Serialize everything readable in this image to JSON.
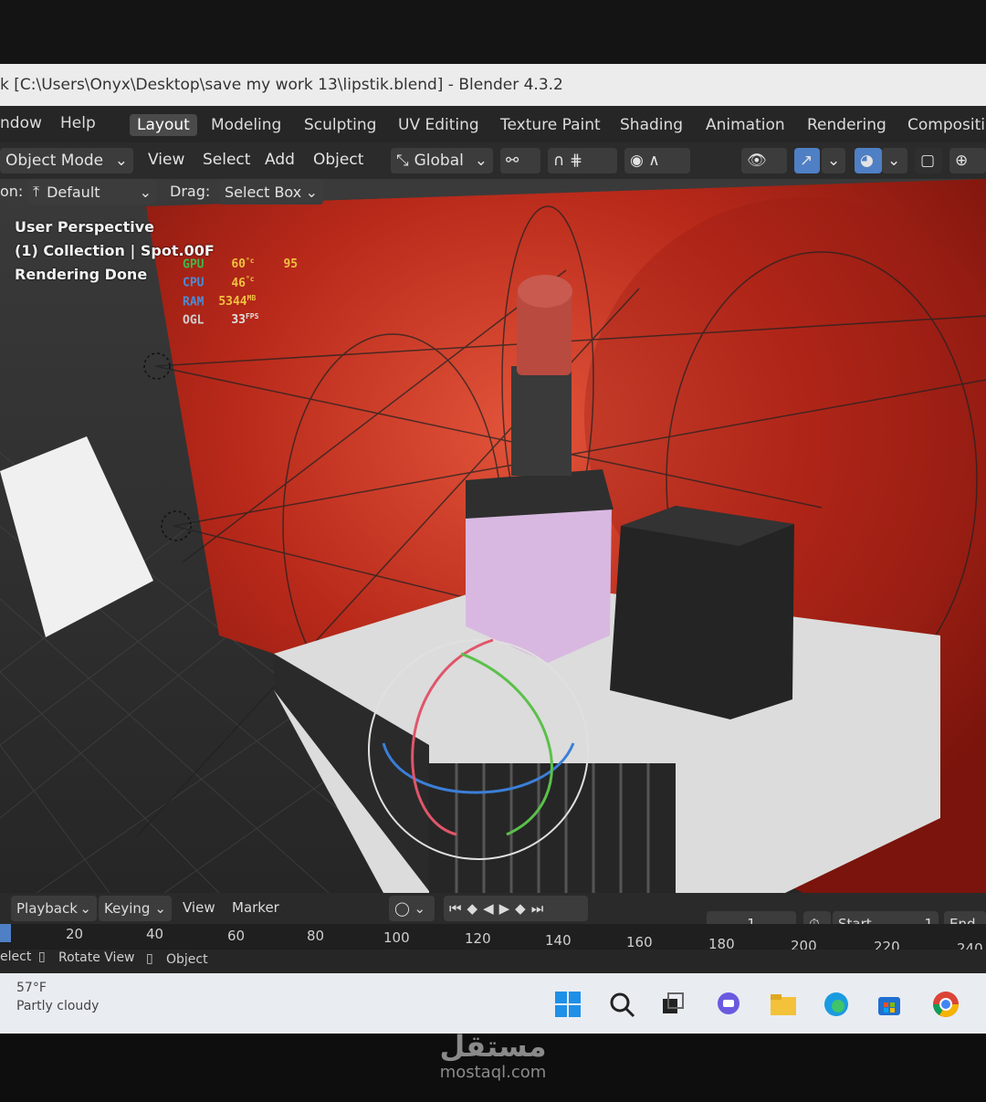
{
  "window": {
    "title": "k [C:\\Users\\Onyx\\Desktop\\save my work 13\\lipstik.blend] - Blender 4.3.2"
  },
  "topbar": {
    "menus": [
      "ndow",
      "Help"
    ],
    "workspaces": [
      "Layout",
      "Modeling",
      "Sculpting",
      "UV Editing",
      "Texture Paint",
      "Shading",
      "Animation",
      "Rendering",
      "Compositin"
    ],
    "active_workspace": "Layout"
  },
  "viewport_header": {
    "mode": "Object Mode",
    "menus": [
      "View",
      "Select",
      "Add",
      "Object"
    ],
    "orientation": "Global"
  },
  "tool_header": {
    "orientation_label": "on:",
    "orientation_value": "Default",
    "drag_label": "Drag:",
    "drag_value": "Select Box"
  },
  "viewport": {
    "perspective": "User Perspective",
    "collection": "(1) Collection | Spot.00F",
    "status": "Rendering Done"
  },
  "stats": [
    {
      "label": "GPU",
      "value": "60",
      "unit": "°c",
      "extra": "95",
      "color": "#3fb84a"
    },
    {
      "label": "CPU",
      "value": "46",
      "unit": "°c",
      "extra": "",
      "color": "#4a8cd8"
    },
    {
      "label": "RAM",
      "value": "5344",
      "unit": "MB",
      "extra": "",
      "color": "#4a8cd8"
    },
    {
      "label": "OGL",
      "value": "33",
      "unit": "FPS",
      "extra": "",
      "color": "#cfcfcf"
    }
  ],
  "timeline": {
    "menus": [
      "Playback",
      "Keying",
      "View",
      "Marker"
    ],
    "current_frame": "1",
    "start_label": "Start",
    "start_value": "1",
    "end_label": "End",
    "ruler": [
      "20",
      "40",
      "60",
      "80",
      "100",
      "120",
      "140",
      "160",
      "180",
      "200",
      "220",
      "240"
    ]
  },
  "statusbar": {
    "items": [
      "elect",
      "Rotate View",
      "Object"
    ]
  },
  "taskbar": {
    "weather_temp": "57°F",
    "weather_desc": "Partly cloudy"
  },
  "watermark": {
    "arabic": "مستقل",
    "latin": "mostaql.com"
  },
  "colors": {
    "backdrop_red": "#b02418",
    "blender_dark": "#262626",
    "active_blue": "#4f7fc4"
  }
}
